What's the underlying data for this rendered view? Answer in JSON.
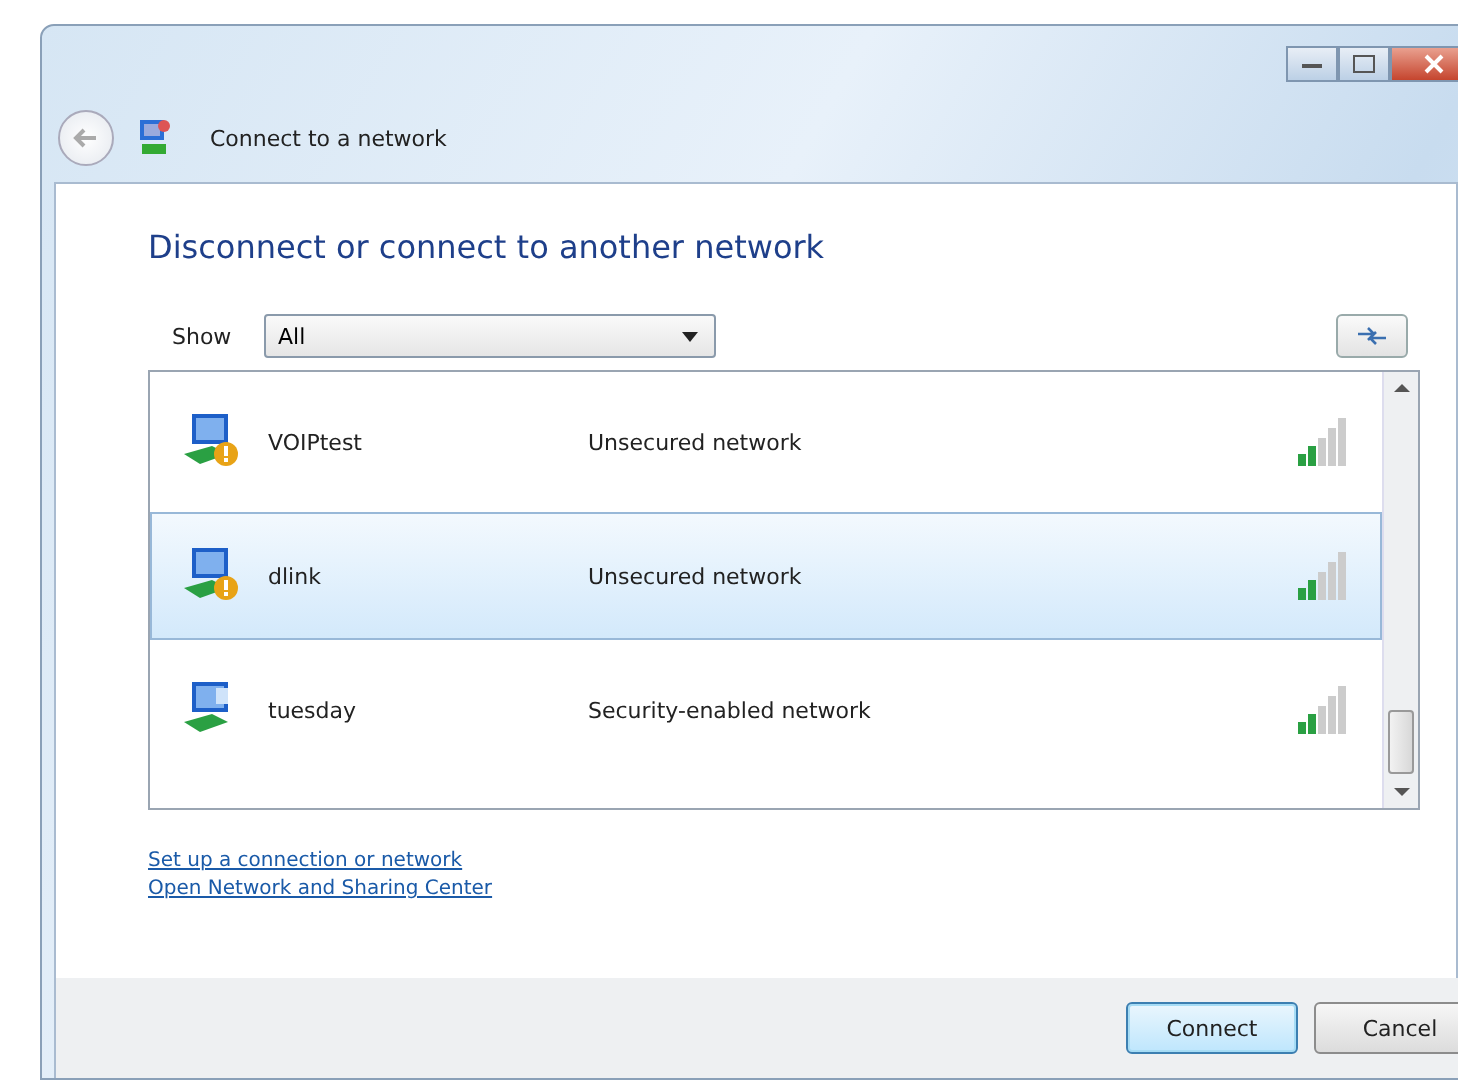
{
  "window": {
    "title": "Connect to a network"
  },
  "heading": "Disconnect or connect to another network",
  "filter": {
    "label": "Show",
    "value": "All"
  },
  "networks": [
    {
      "name": "VOIPtest",
      "security": "Unsecured network",
      "secured": false,
      "selected": false
    },
    {
      "name": "dlink",
      "security": "Unsecured network",
      "secured": false,
      "selected": true
    },
    {
      "name": "tuesday",
      "security": "Security-enabled network",
      "secured": true,
      "selected": false
    }
  ],
  "links": [
    "Set up a connection or network",
    "Open Network and Sharing Center"
  ],
  "buttons": [
    {
      "label": "Connect",
      "kind": "default"
    },
    {
      "label": "Cancel",
      "kind": "normal"
    }
  ]
}
